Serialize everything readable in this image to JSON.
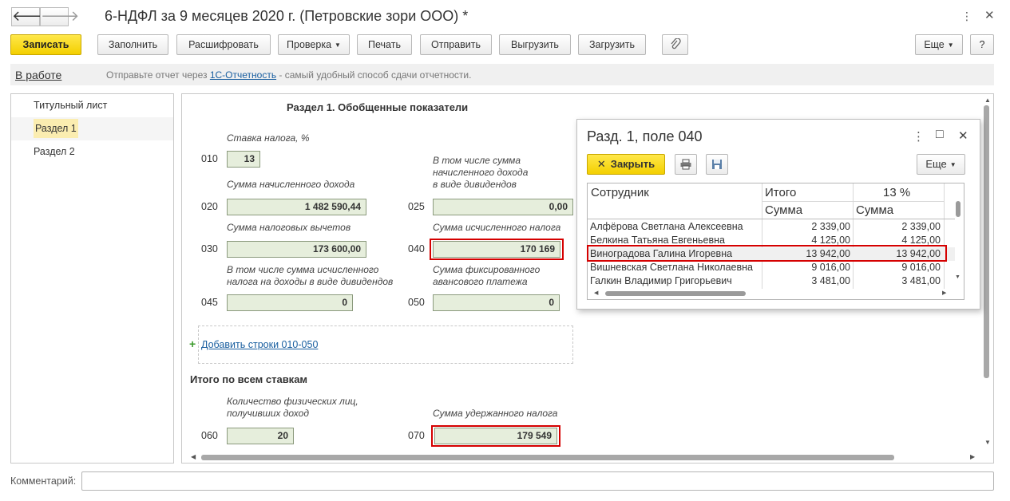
{
  "window": {
    "title": "6-НДФЛ за 9 месяцев 2020 г. (Петровские зори ООО) *",
    "back_glyph": "🡐",
    "forward_glyph": "🡒",
    "more_glyph": "⋮",
    "maximize_glyph": "□",
    "close_glyph": "✕"
  },
  "toolbar": {
    "save": "Записать",
    "fill": "Заполнить",
    "decode": "Расшифровать",
    "check": "Проверка",
    "print": "Печать",
    "send": "Отправить",
    "export": "Выгрузить",
    "import": "Загрузить",
    "more": "Еще",
    "help": "?"
  },
  "infobar": {
    "status": "В работе",
    "text_before": "Отправьте отчет через ",
    "link": "1С-Отчетность",
    "text_after": " - самый удобный способ сдачи отчетности."
  },
  "sidebar": {
    "items": [
      {
        "label": "Титульный лист"
      },
      {
        "label": "Раздел 1"
      },
      {
        "label": "Раздел 2"
      }
    ]
  },
  "form": {
    "section_title": "Раздел 1. Обобщенные показатели",
    "rate_label": "Ставка налога, %",
    "code_010": "010",
    "value_010": "13",
    "income_label": "Сумма начисленного дохода",
    "code_020": "020",
    "value_020": "1 482 590,44",
    "dividends_label_1": "В том числе сумма",
    "dividends_label_2": "начисленного дохода",
    "dividends_label_3": "в виде дивидендов",
    "code_025": "025",
    "value_025": "0,00",
    "deductions_label": "Сумма налоговых вычетов",
    "code_030": "030",
    "value_030": "173 600,00",
    "calc_tax_label": "Сумма исчисленного налога",
    "code_040": "040",
    "value_040": "170 169",
    "div_tax_label_1": "В том числе сумма исчисленного",
    "div_tax_label_2": "налога на доходы в виде дивидендов",
    "code_045": "045",
    "value_045": "0",
    "fixed_label_1": "Сумма фиксированного",
    "fixed_label_2": "авансового платежа",
    "code_050": "050",
    "value_050": "0",
    "add_rows": "Добавить строки 010-050",
    "total_title": "Итого по всем ставкам",
    "persons_label_1": "Количество физических лиц,",
    "persons_label_2": "получивших доход",
    "code_060": "060",
    "value_060": "20",
    "withheld_label": "Сумма удержанного налога",
    "code_070": "070",
    "value_070": "179 549"
  },
  "popup": {
    "title": "Разд. 1, поле 040",
    "close_button": "Закрыть",
    "more": "Еще",
    "columns": {
      "employee": "Сотрудник",
      "total": "Итого",
      "rate": "13 %",
      "sum1": "Сумма",
      "sum2": "Сумма"
    },
    "rows": [
      {
        "name": "Алфёрова Светлана Алексеевна",
        "total": "2 339,00",
        "rate13": "2 339,00"
      },
      {
        "name": "Белкина Татьяна Евгеньевна",
        "total": "4 125,00",
        "rate13": "4 125,00"
      },
      {
        "name": "Виноградова Галина Игоревна",
        "total": "13 942,00",
        "rate13": "13 942,00"
      },
      {
        "name": "Вишневская Светлана Николаевна",
        "total": "9 016,00",
        "rate13": "9 016,00"
      },
      {
        "name": "Галкин Владимир Григорьевич",
        "total": "3 481,00",
        "rate13": "3 481,00"
      }
    ]
  },
  "comment": {
    "label": "Комментарий:",
    "value": ""
  },
  "colors": {
    "accent_yellow": "#f3cf00",
    "highlight_red": "#d50000",
    "field_green": "#e6eedc",
    "selected_nav": "#fbedb0",
    "link_blue": "#1a5fa0"
  }
}
